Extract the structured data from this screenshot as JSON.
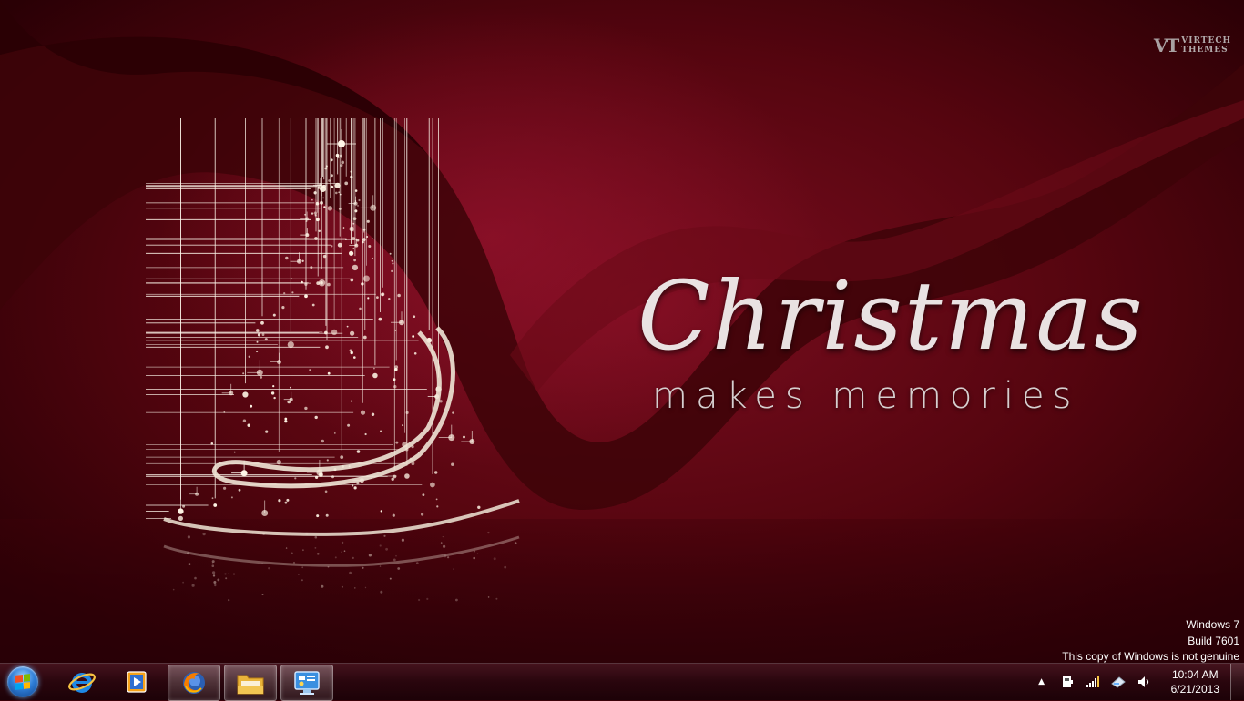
{
  "wallpaper": {
    "headline": "Christmas",
    "subline": "makes memories",
    "logo_mark": "VT",
    "logo_word_1": "VIRTECH",
    "logo_word_2": "THEMES"
  },
  "watermark": {
    "line1": "Windows 7",
    "line2": "Build 7601",
    "line3": "This copy of Windows is not genuine"
  },
  "taskbar": {
    "pinned": [
      {
        "name": "internet-explorer-icon"
      },
      {
        "name": "media-player-icon"
      },
      {
        "name": "firefox-icon",
        "active": true
      },
      {
        "name": "windows-explorer-icon"
      },
      {
        "name": "control-panel-icon"
      }
    ],
    "tray": {
      "show_hidden": "▲",
      "clock_time": "10:04 AM",
      "clock_date": "6/21/2013"
    }
  },
  "colors": {
    "background": "#55050f",
    "accent": "#7a0d1f",
    "text": "#ffffff"
  }
}
